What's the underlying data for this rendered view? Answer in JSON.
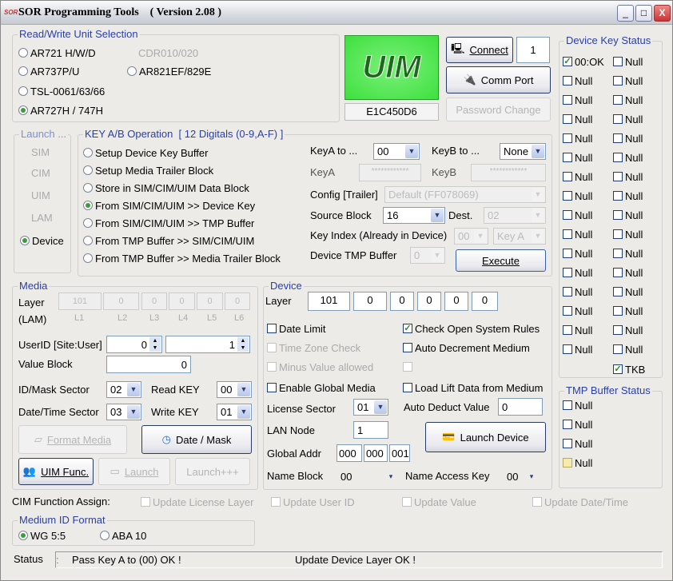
{
  "window": {
    "title": "SOR Programming Tools    ( Version 2.08 )",
    "logo": "SOR",
    "minimize": "_",
    "maximize": "□",
    "close": "X"
  },
  "rw": {
    "title": "Read/Write Unit Selection",
    "options": [
      "AR721 H/W/D",
      "CDR010/020",
      "AR737P/U",
      "AR821EF/829E",
      "TSL-0061/63/66",
      "AR727H / 747H"
    ],
    "selected": "AR727H / 747H"
  },
  "uim": {
    "logo": "UIM",
    "id": "E1C450D6",
    "logo_color": "#3ee03e"
  },
  "conn": {
    "connect": "Connect",
    "port_no": "1",
    "comm_port": "Comm Port",
    "password": "Password Change"
  },
  "dks": {
    "title": "Device Key Status",
    "col1": [
      "00:OK",
      "Null",
      "Null",
      "Null",
      "Null",
      "Null",
      "Null",
      "Null",
      "Null",
      "Null",
      "Null",
      "Null",
      "Null",
      "Null",
      "Null",
      "Null"
    ],
    "col2": [
      "Null",
      "Null",
      "Null",
      "Null",
      "Null",
      "Null",
      "Null",
      "Null",
      "Null",
      "Null",
      "Null",
      "Null",
      "Null",
      "Null",
      "Null",
      "Null",
      "TKB"
    ]
  },
  "tmp": {
    "title": "TMP Buffer Status",
    "items": [
      "Null",
      "Null",
      "Null",
      "Null"
    ]
  },
  "launch": {
    "title": "Launch ...",
    "items": [
      "SIM",
      "CIM",
      "UIM",
      "LAM"
    ],
    "device": "Device"
  },
  "keyab": {
    "title": "KEY A/B Operation  [ 12 Digitals (0-9,A-F) ]",
    "ops": [
      "Setup Device Key Buffer",
      "Setup Media Trailer Block",
      "Store in SIM/CIM/UIM Data Block",
      "From SIM/CIM/UIM  >> Device Key",
      "From SIM/CIM/UIM  >> TMP Buffer",
      "From TMP Buffer >> SIM/CIM/UIM",
      "From TMP Buffer >> Media Trailer Block"
    ],
    "selected": "From SIM/CIM/UIM  >> Device Key",
    "keya_to": "KeyA  to ...",
    "keya_to_val": "00",
    "keyb_to": "KeyB  to ...",
    "keyb_to_val": "None",
    "keya": "KeyA",
    "keya_val": "************",
    "keyb": "KeyB",
    "keyb_val": "************",
    "config": "Config [Trailer]",
    "config_val": "Default (FF078069)",
    "source": "Source Block",
    "source_val": "16",
    "dest": "Dest.",
    "dest_val": "02",
    "keyidx": "Key Index (Already in Device)",
    "keyidx_val": "00",
    "keyidx_type": "Key A",
    "tmpbuf": "Device TMP Buffer",
    "tmpbuf_val": "0",
    "execute": "Execute"
  },
  "media": {
    "title": "Media",
    "layer": "Layer",
    "lam": "(LAM)",
    "layers": [
      "101",
      "0",
      "0",
      "0",
      "0",
      "0"
    ],
    "layer_labels": [
      "L1",
      "L2",
      "L3",
      "L4",
      "L5",
      "L6"
    ],
    "userid": "UserID [Site:User]",
    "site": "0",
    "user": "1",
    "value_block": "Value Block",
    "value": "0",
    "idmask": "ID/Mask Sector",
    "idmask_val": "02",
    "readkey": "Read KEY",
    "readkey_val": "00",
    "datetime": "Date/Time Sector",
    "datetime_val": "03",
    "writekey": "Write KEY",
    "writekey_val": "01",
    "format": "Format Media",
    "datemask": "Date / Mask",
    "uimfunc": "UIM Func.",
    "launch": "Launch",
    "launchppp": "Launch+++"
  },
  "device": {
    "title": "Device",
    "layer": "Layer",
    "layers": [
      "101",
      "0",
      "0",
      "0",
      "0",
      "0"
    ],
    "date_limit": "Date Limit",
    "check_open": "Check Open System Rules",
    "time_zone": "Time Zone Check",
    "auto_dec": "Auto Decrement Medium",
    "minus": "Minus Value allowed",
    "enable_global": "Enable Global Media",
    "load_lift": "Load Lift Data from Medium",
    "license": "License Sector",
    "license_val": "01",
    "auto_deduct": "Auto Deduct Value",
    "auto_deduct_val": "0",
    "lan": "LAN Node",
    "lan_val": "1",
    "launch_device": "Launch Device",
    "global": "Global Addr",
    "global_vals": [
      "000",
      "000",
      "001"
    ],
    "name_block": "Name Block",
    "name_block_val": "00",
    "name_access": "Name Access Key",
    "name_access_val": "00"
  },
  "cim": {
    "label": "CIM Function Assign:",
    "items": [
      "Update License Layer",
      "Update User ID",
      "Update Value",
      "Update Date/Time"
    ]
  },
  "mid": {
    "title": "Medium ID Format",
    "wg": "WG 5:5",
    "aba": "ABA 10"
  },
  "status": {
    "label": "Status",
    "sep": ":",
    "msg1": "Pass Key A to (00)  OK !",
    "msg2": "Update Device Layer OK !"
  }
}
